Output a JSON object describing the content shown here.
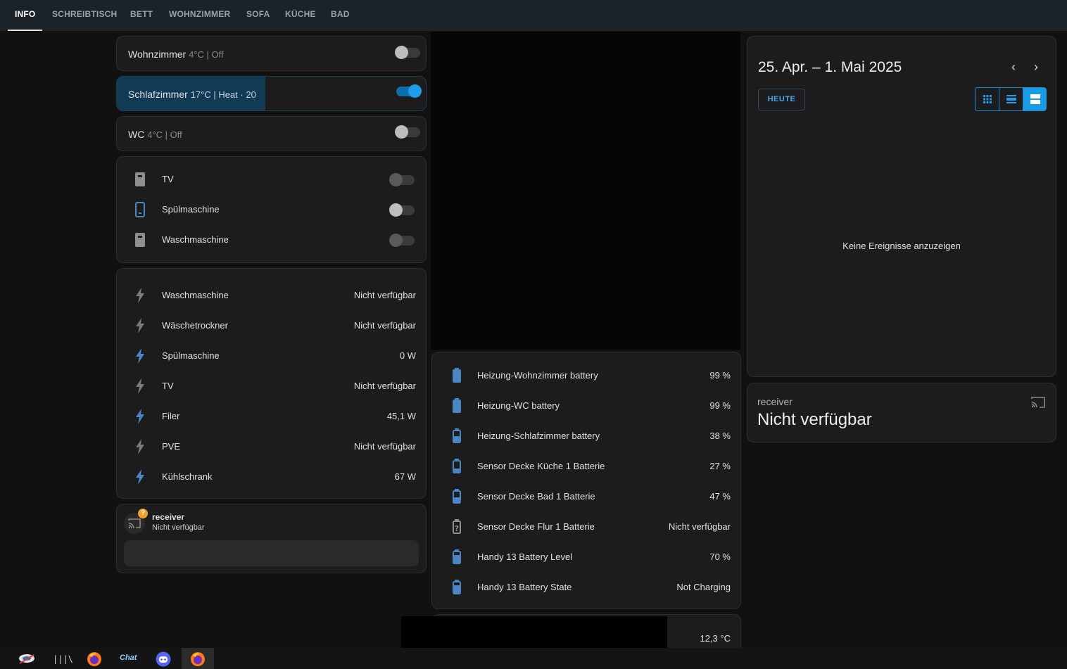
{
  "nav": {
    "tabs": [
      "INFO",
      "SCHREIBTISCH",
      "BETT",
      "WOHNZIMMER",
      "SOFA",
      "KÜCHE",
      "BAD"
    ],
    "active": "INFO"
  },
  "climate": [
    {
      "name": "Wohnzimmer",
      "state": "4°C | Off",
      "on": false
    },
    {
      "name": "Schlafzimmer",
      "state": "17°C | Heat · 20",
      "on": true
    },
    {
      "name": "WC",
      "state": "4°C | Off",
      "on": false
    }
  ],
  "switches": [
    {
      "label": "TV",
      "icon": "socket-icon",
      "on": false
    },
    {
      "label": "Spülmaschine",
      "icon": "socket-icon",
      "on": false
    },
    {
      "label": "Waschmaschine",
      "icon": "socket-icon",
      "on": false
    }
  ],
  "power": [
    {
      "label": "Waschmaschine",
      "value": "Nicht verfügbar"
    },
    {
      "label": "Wäschetrockner",
      "value": "Nicht verfügbar"
    },
    {
      "label": "Spülmaschine",
      "value": "0 W"
    },
    {
      "label": "TV",
      "value": "Nicht verfügbar"
    },
    {
      "label": "Filer",
      "value": "45,1 W"
    },
    {
      "label": "PVE",
      "value": "Nicht verfügbar"
    },
    {
      "label": "Kühlschrank",
      "value": "67 W"
    }
  ],
  "media_small": {
    "name": "receiver",
    "state": "Nicht verfügbar",
    "badge": "?"
  },
  "batteries": [
    {
      "label": "Heizung-Wohnzimmer battery",
      "value": "99 %"
    },
    {
      "label": "Heizung-WC battery",
      "value": "99 %"
    },
    {
      "label": "Heizung-Schlafzimmer battery",
      "value": "38 %"
    },
    {
      "label": "Sensor Decke Küche 1 Batterie",
      "value": "27 %"
    },
    {
      "label": "Sensor Decke Bad 1 Batterie",
      "value": "47 %"
    },
    {
      "label": "Sensor Decke Flur 1 Batterie",
      "value": "Nicht verfügbar"
    },
    {
      "label": "Handy 13 Battery Level",
      "value": "70 %"
    },
    {
      "label": "Handy 13 Battery State",
      "value": "Not Charging"
    }
  ],
  "temperature": {
    "value": "12,3 °C"
  },
  "calendar": {
    "title": "25. Apr. – 1. Mai 2025",
    "today_label": "HEUTE",
    "empty_text": "Keine Ereignisse anzuzeigen",
    "prev": "‹",
    "next": "›"
  },
  "media_large": {
    "name": "receiver",
    "state": "Nicht verfügbar"
  },
  "taskbar": {
    "chat_label": "Chat",
    "library_label": "|||\\",
    "items": [
      "app-icon",
      "library-icon",
      "firefox-icon",
      "chat-icon",
      "discord-icon",
      "firefox-icon"
    ]
  },
  "colors": {
    "accent": "#1e9be9",
    "heat": "#123a55",
    "battery": "#4c85c4",
    "background": "#111111"
  }
}
